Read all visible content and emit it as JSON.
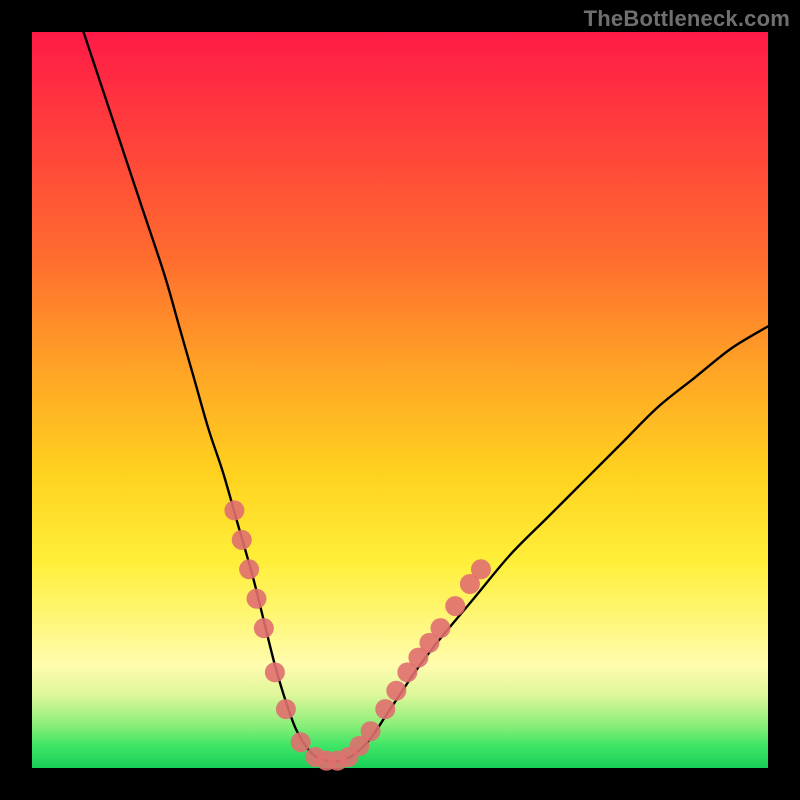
{
  "watermark": "TheBottleneck.com",
  "chart_data": {
    "type": "line",
    "title": "",
    "xlabel": "",
    "ylabel": "",
    "xlim": [
      0,
      100
    ],
    "ylim": [
      0,
      100
    ],
    "grid": false,
    "series": [
      {
        "name": "bottleneck-curve",
        "x": [
          7,
          10,
          12,
          15,
          18,
          20,
          22,
          24,
          26,
          28,
          30,
          31.5,
          33,
          34.5,
          36,
          38,
          40,
          42,
          44,
          46,
          48,
          50,
          52,
          55,
          60,
          65,
          70,
          75,
          80,
          85,
          90,
          95,
          100
        ],
        "values": [
          100,
          91,
          85,
          76,
          67,
          60,
          53,
          46,
          40,
          33,
          26,
          20,
          14,
          9,
          5,
          2,
          1,
          1,
          2,
          4,
          7,
          10,
          13,
          17,
          23,
          29,
          34,
          39,
          44,
          49,
          53,
          57,
          60
        ]
      }
    ],
    "markers": {
      "name": "highlight-dots",
      "color": "#e06f6f",
      "points": [
        {
          "x": 27.5,
          "y": 35
        },
        {
          "x": 28.5,
          "y": 31
        },
        {
          "x": 29.5,
          "y": 27
        },
        {
          "x": 30.5,
          "y": 23
        },
        {
          "x": 31.5,
          "y": 19
        },
        {
          "x": 33.0,
          "y": 13
        },
        {
          "x": 34.5,
          "y": 8
        },
        {
          "x": 36.5,
          "y": 3.5
        },
        {
          "x": 38.5,
          "y": 1.5
        },
        {
          "x": 40.0,
          "y": 1
        },
        {
          "x": 41.5,
          "y": 1
        },
        {
          "x": 43.0,
          "y": 1.5
        },
        {
          "x": 44.5,
          "y": 3
        },
        {
          "x": 46.0,
          "y": 5
        },
        {
          "x": 48.0,
          "y": 8
        },
        {
          "x": 49.5,
          "y": 10.5
        },
        {
          "x": 51.0,
          "y": 13
        },
        {
          "x": 52.5,
          "y": 15
        },
        {
          "x": 54.0,
          "y": 17
        },
        {
          "x": 55.5,
          "y": 19
        },
        {
          "x": 57.5,
          "y": 22
        },
        {
          "x": 59.5,
          "y": 25
        },
        {
          "x": 61.0,
          "y": 27
        }
      ]
    }
  }
}
